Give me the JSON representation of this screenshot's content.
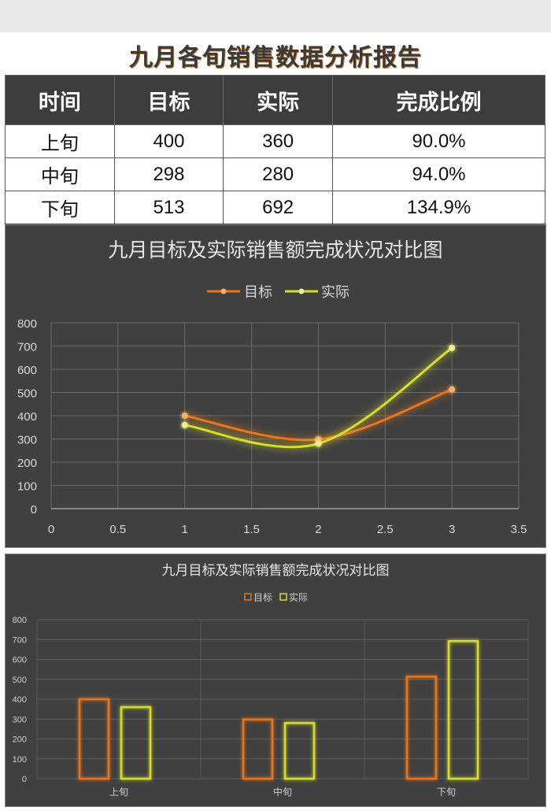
{
  "report": {
    "title": "九月各旬销售数据分析报告"
  },
  "table": {
    "headers": [
      "时间",
      "目标",
      "实际",
      "完成比例"
    ],
    "rows": [
      [
        "上旬",
        "400",
        "360",
        "90.0%"
      ],
      [
        "中旬",
        "298",
        "280",
        "94.0%"
      ],
      [
        "下旬",
        "513",
        "692",
        "134.9%"
      ]
    ]
  },
  "colors": {
    "target": "#e8761e",
    "actual": "#d6de2c",
    "panel_bg": "#404040",
    "grid": "#6a6a6a",
    "text": "#d9d9d9"
  },
  "chart_data": [
    {
      "type": "line",
      "title": "九月目标及实际销售额完成状况对比图",
      "xlabel": "",
      "ylabel": "",
      "xlim": [
        0,
        3.5
      ],
      "ylim": [
        0,
        800
      ],
      "xticks": [
        "0",
        "0.5",
        "1",
        "1.5",
        "2",
        "2.5",
        "3",
        "3.5"
      ],
      "yticks": [
        "0",
        "100",
        "200",
        "300",
        "400",
        "500",
        "600",
        "700",
        "800"
      ],
      "grid": true,
      "smooth": true,
      "legend": "top-center",
      "x": [
        1,
        2,
        3
      ],
      "series": [
        {
          "name": "目标",
          "values": [
            400,
            298,
            513
          ]
        },
        {
          "name": "实际",
          "values": [
            360,
            280,
            692
          ]
        }
      ]
    },
    {
      "type": "bar",
      "title": "九月目标及实际销售额完成状况对比图",
      "xlabel": "",
      "ylabel": "",
      "ylim": [
        0,
        800
      ],
      "yticks": [
        "0",
        "100",
        "200",
        "300",
        "400",
        "500",
        "600",
        "700",
        "800"
      ],
      "grid": true,
      "legend": "top-center",
      "categories": [
        "上旬",
        "中旬",
        "下旬"
      ],
      "series": [
        {
          "name": "目标",
          "values": [
            400,
            298,
            513
          ]
        },
        {
          "name": "实际",
          "values": [
            360,
            280,
            692
          ]
        }
      ]
    }
  ]
}
